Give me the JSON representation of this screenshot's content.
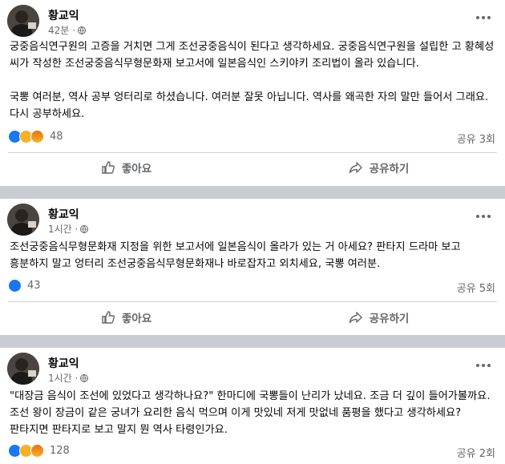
{
  "posts": [
    {
      "author": "황교익",
      "time": "42분 ·",
      "body": "궁중음식연구원의 고증을 거치면 그게 조선궁중음식이 된다고 생각하세요. 궁중음식연구원을 설립한 고 황혜성 씨가 작성한 조선궁중음식무형문화재 보고서에 일본음식인 스키야키 조리법이 올라 있습니다.\n\n국뽕 여러분, 역사 공부 엉터리로 하셨습니다. 여러분 잘못 아닙니다. 역사를 왜곡한 자의 말만 들어서 그래요. 다시 공부하세요.",
      "reaction_icons": [
        "like-icon",
        "sad-icon",
        "angry-icon"
      ],
      "reaction_count": "48",
      "shares": "공유 3회",
      "like_label": "좋아요",
      "share_label": "공유하기"
    },
    {
      "author": "황교익",
      "time": "1시간 ·",
      "body": "조선궁중음식무형문화재 지정을 위한 보고서에 일본음식이 올라가 있는 거 아세요? 판타지 드라마 보고 흥분하지 말고 엉터리 조선궁중음식무형문화재나 바로잡자고 외치세요, 국뽕 여러분.",
      "reaction_icons": [
        "like-icon"
      ],
      "reaction_count": "43",
      "shares": "공유 5회",
      "like_label": "좋아요",
      "share_label": "공유하기"
    },
    {
      "author": "황교익",
      "time": "1시간 ·",
      "body": "\"대장금 음식이 조선에 있었다고 생각하나요?\" 한마디에 국뽕들이 난리가 났네요. 조금 더 깊이 들어가볼까요. 조선 왕이 장금이 같은 궁녀가 요리한 음식 먹으며 이게 맛있네 저게 맛없네 품평을 했다고 생각하세요? 판타지면 판타지로 보고 말지 뭔 역사 타령인가요.",
      "reaction_icons": [
        "like-icon",
        "haha-icon",
        "angry-icon"
      ],
      "reaction_count": "128",
      "shares": "공유 2회"
    }
  ]
}
